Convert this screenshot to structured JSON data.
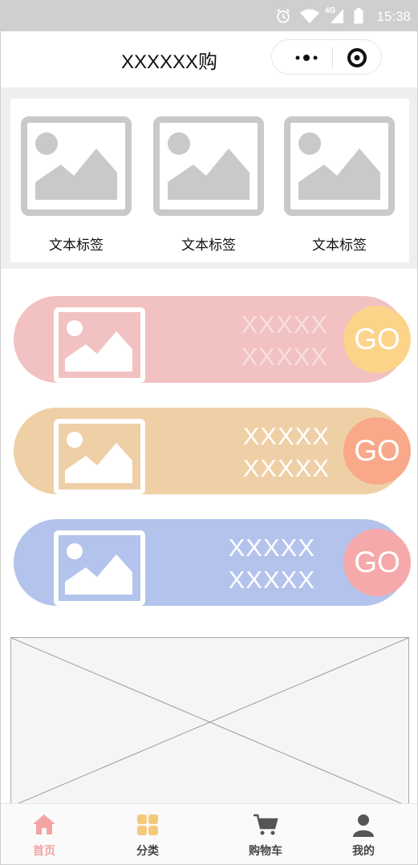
{
  "status_bar": {
    "time": "15:38",
    "network": "4G",
    "icons": [
      "alarm-icon",
      "wifi-icon",
      "signal-icon",
      "battery-icon"
    ]
  },
  "nav": {
    "title": "XXXXXX购",
    "capsule": {
      "more_icon": "more-dots-icon",
      "close_icon": "target-circle-icon"
    }
  },
  "grid": {
    "items": [
      {
        "label": "文本标签",
        "icon": "image-placeholder-icon"
      },
      {
        "label": "文本标签",
        "icon": "image-placeholder-icon"
      },
      {
        "label": "文本标签",
        "icon": "image-placeholder-icon"
      }
    ]
  },
  "banners": [
    {
      "line1": "XXXXX",
      "line2": "XXXXX",
      "go": "GO",
      "color": "#f2c1c1",
      "go_color": "#fbd48a",
      "text_color": "#f7dede"
    },
    {
      "line1": "XXXXX",
      "line2": "XXXXX",
      "go": "GO",
      "color": "#efcfa6",
      "go_color": "#f9a98a",
      "text_color": "#ffffff"
    },
    {
      "line1": "XXXXX",
      "line2": "XXXXX",
      "go": "GO",
      "color": "#b3c3ec",
      "go_color": "#f6a9aa",
      "text_color": "#ffffff"
    }
  ],
  "tabs": [
    {
      "label": "首页",
      "icon": "home-icon",
      "active": true,
      "color": "#f4a3a4"
    },
    {
      "label": "分类",
      "icon": "category-grid-icon",
      "active": false,
      "color": "#f5c97c"
    },
    {
      "label": "购物车",
      "icon": "shopping-cart-icon",
      "active": false,
      "color": "#555555"
    },
    {
      "label": "我的",
      "icon": "user-icon",
      "active": false,
      "color": "#555555"
    }
  ]
}
